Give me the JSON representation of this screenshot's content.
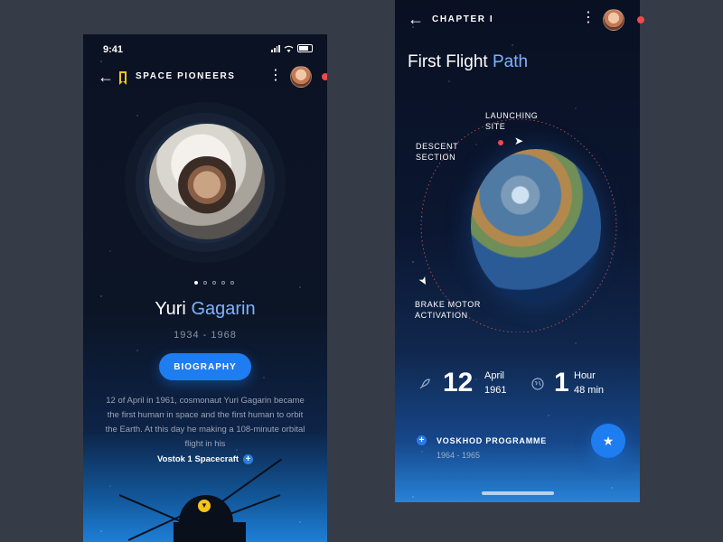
{
  "left": {
    "status_time": "9:41",
    "header_title": "SPACE PIONEERS",
    "first_name": "Yuri",
    "last_name": "Gagarin",
    "years": "1934 - 1968",
    "button_label": "BIOGRAPHY",
    "bio_text": "12 of April in 1961, cosmonaut Yuri Gagarin became the first human in space and the first human to orbit the Earth. At this day he making a 108-minute orbital flight in his",
    "bio_link": "Vostok 1 Spacecraft",
    "carousel": {
      "count": 5,
      "active_index": 0
    }
  },
  "right": {
    "chapter": "CHAPTER I",
    "title_main": "First Flight",
    "title_accent": "Path",
    "labels": {
      "launching": "LAUNCHING SITE",
      "descent": "DESCENT SECTION",
      "brake": "BRAKE MOTOR ACTIVATION"
    },
    "stats": [
      {
        "num": "12",
        "line1": "April",
        "line2": "1961",
        "icon": "rocket-icon"
      },
      {
        "num": "1",
        "line1": "Hour",
        "line2": "48 min",
        "icon": "globe-icon"
      }
    ],
    "programme": {
      "name": "VOSKHOD PROGRAMME",
      "years": "1964 - 1965"
    }
  },
  "colors": {
    "accent_blue": "#1e7df0",
    "light_blue_text": "#7fb3ff",
    "gold": "#f5c518",
    "red_dot": "#ef4a4a",
    "background": "#353b47"
  }
}
